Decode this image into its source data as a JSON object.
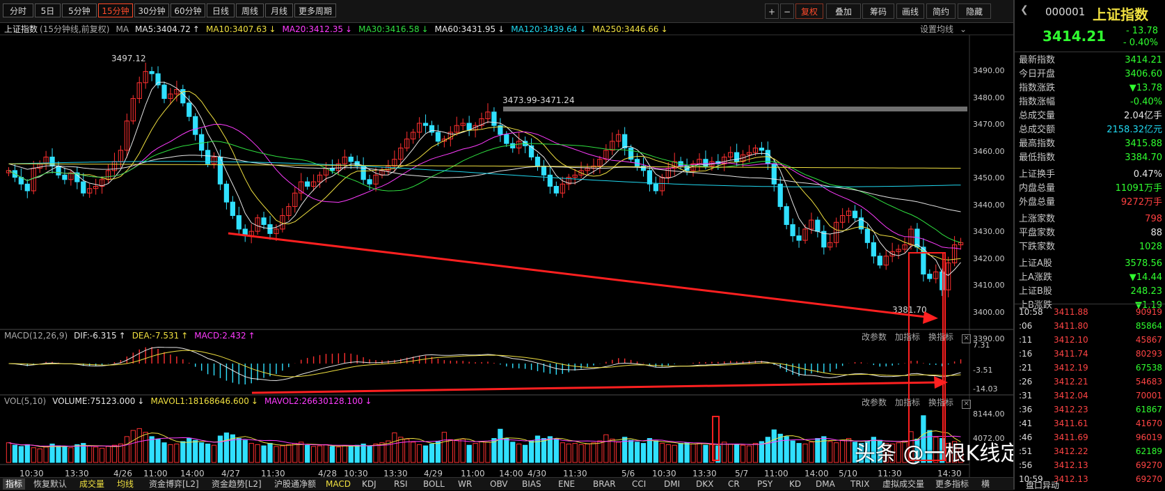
{
  "toolbar": {
    "periods": [
      "分时",
      "5日",
      "5分钟",
      "15分钟",
      "30分钟",
      "60分钟",
      "日线",
      "周线",
      "月线",
      "更多周期"
    ],
    "active_period": "15分钟",
    "right_buttons": [
      "复权",
      "叠加",
      "筹码",
      "画线",
      "简约",
      "隐藏"
    ],
    "plus": "+",
    "minus": "−"
  },
  "main": {
    "index_name": "上证指数",
    "subtitle": "(15分钟线,前复权)",
    "ma_tag": "MA",
    "ma": [
      {
        "label": "MA5:3404.72",
        "arrow": "↑",
        "color": "#e6e6e6"
      },
      {
        "label": "MA10:3407.63",
        "arrow": "↓",
        "color": "#f0e040"
      },
      {
        "label": "MA20:3412.35",
        "arrow": "↓",
        "color": "#ff3cff"
      },
      {
        "label": "MA30:3416.58",
        "arrow": "↓",
        "color": "#2fe040"
      },
      {
        "label": "MA60:3431.95",
        "arrow": "↓",
        "color": "#e6e6e6"
      },
      {
        "label": "MA120:3439.64",
        "arrow": "↓",
        "color": "#20d8f0"
      },
      {
        "label": "MA250:3446.66",
        "arrow": "↓",
        "color": "#f0e040"
      }
    ],
    "settings": "设置均线",
    "high_label": "3497.12",
    "range_label": "3473.99-3471.24",
    "low_label": "3381.70",
    "yticks": [
      "3490.00",
      "3480.00",
      "3470.00",
      "3460.00",
      "3450.00",
      "3440.00",
      "3430.00",
      "3420.00",
      "3410.00",
      "3400.00",
      "3390.00"
    ]
  },
  "macd": {
    "title": "MACD(12,26,9)",
    "dif": "DIF:-6.315",
    "dif_arrow": "↑",
    "dea": "DEA:-7.531",
    "dea_arrow": "↑",
    "macd": "MACD:2.432",
    "macd_arrow": "↑",
    "tools": [
      "改参数",
      "加指标",
      "换指标"
    ],
    "close": "×",
    "yticks": [
      "7.31",
      "-3.51",
      "-14.03"
    ]
  },
  "vol": {
    "title": "VOL(5,10)",
    "volume": "VOLUME:75123.000",
    "volume_arrow": "↓",
    "mavol1": "MAVOL1:18168646.600",
    "mavol1_arrow": "↓",
    "mavol2": "MAVOL2:26630128.100",
    "mavol2_arrow": "↓",
    "tools": [
      "改参数",
      "加指标",
      "换指标"
    ],
    "close": "×",
    "yticks": [
      "8144.00",
      "4072.00"
    ]
  },
  "xaxis": [
    "10:30",
    "13:30",
    "4/26",
    "11:00",
    "14:00",
    "4/27",
    "11:30",
    "4/28",
    "10:30",
    "13:30",
    "4/29",
    "11:00",
    "14:00",
    "4/30",
    "11:30",
    "5/6",
    "10:30",
    "13:30",
    "5/7",
    "11:00",
    "14:00",
    "5/10",
    "11:30",
    "14:30"
  ],
  "bottom_tabs": [
    "指标",
    "恢复默认",
    "成交量",
    "均线",
    "资金博弈[L2]",
    "资金趋势[L2]",
    "沪股通净额",
    "MACD",
    "KDJ",
    "RSI",
    "BOLL",
    "WR",
    "OBV",
    "BIAS",
    "ENE",
    "BRAR",
    "CCI",
    "DMI",
    "DKX",
    "CR",
    "PSY",
    "KD",
    "DMA",
    "TRIX",
    "虚拟成交量",
    "更多指标",
    "横"
  ],
  "watermark": "头条 @一根K线定乾坤",
  "quote": {
    "code": "000001",
    "name": "上证指数",
    "price": "3414.21",
    "change": "- 13.78",
    "pct": "- 0.40%",
    "stats": [
      {
        "k": "最新指数",
        "v": "3414.21",
        "c": "#30ff30"
      },
      {
        "k": "今日开盘",
        "v": "3406.60",
        "c": "#30ff30"
      },
      {
        "k": "指数涨跌",
        "v": "▼13.78",
        "c": "#30ff30"
      },
      {
        "k": "指数涨幅",
        "v": "-0.40%",
        "c": "#30ff30"
      },
      {
        "k": "总成交量",
        "v": "2.04亿手",
        "c": "#e6e6e6"
      },
      {
        "k": "总成交额",
        "v": "2158.32亿元",
        "c": "#20d8f0"
      },
      {
        "k": "最高指数",
        "v": "3415.88",
        "c": "#30ff30"
      },
      {
        "k": "最低指数",
        "v": "3384.70",
        "c": "#30ff30"
      },
      {
        "k": "上证换手",
        "v": "0.47%",
        "c": "#e6e6e6"
      },
      {
        "k": "内盘总量",
        "v": "11091万手",
        "c": "#30ff30"
      },
      {
        "k": "外盘总量",
        "v": "9272万手",
        "c": "#ff4040"
      },
      {
        "k": "上涨家数",
        "v": "798",
        "c": "#ff4040"
      },
      {
        "k": "平盘家数",
        "v": "88",
        "c": "#e6e6e6"
      },
      {
        "k": "下跌家数",
        "v": "1028",
        "c": "#30ff30"
      },
      {
        "k": "上证A股",
        "v": "3578.56",
        "c": "#30ff30"
      },
      {
        "k": "上A涨跌",
        "v": "▼14.44",
        "c": "#30ff30"
      },
      {
        "k": "上证B股",
        "v": "248.23",
        "c": "#30ff30"
      },
      {
        "k": "上B涨跌",
        "v": "▼1.19",
        "c": "#30ff30"
      }
    ],
    "ticks": [
      {
        "t": "10:58",
        "p": "3411.88",
        "v": "90919"
      },
      {
        "t": ":06",
        "p": "3411.80",
        "v": "85864"
      },
      {
        "t": ":11",
        "p": "3412.10",
        "v": "45867"
      },
      {
        "t": ":16",
        "p": "3411.74",
        "v": "80293"
      },
      {
        "t": ":21",
        "p": "3412.19",
        "v": "67538"
      },
      {
        "t": ":26",
        "p": "3412.21",
        "v": "54683"
      },
      {
        "t": ":31",
        "p": "3412.04",
        "v": "70001"
      },
      {
        "t": ":36",
        "p": "3412.23",
        "v": "61867"
      },
      {
        "t": ":41",
        "p": "3411.61",
        "v": "41670"
      },
      {
        "t": ":46",
        "p": "3411.69",
        "v": "96019"
      },
      {
        "t": ":51",
        "p": "3412.22",
        "v": "62189"
      },
      {
        "t": ":56",
        "p": "3412.13",
        "v": "69270"
      },
      {
        "t": "10:59",
        "p": "3412.13",
        "v": "69270"
      }
    ],
    "footer": "盘口异动"
  },
  "chart_data": {
    "type": "candlestick",
    "title": "上证指数 15分钟线",
    "closes": [
      3446,
      3443,
      3440,
      3437,
      3447,
      3449,
      3452,
      3448,
      3444,
      3442,
      3445,
      3441,
      3436,
      3438,
      3439,
      3442,
      3446,
      3450,
      3455,
      3468,
      3478,
      3485,
      3490,
      3489,
      3484,
      3478,
      3480,
      3482,
      3476,
      3470,
      3462,
      3455,
      3449,
      3452,
      3440,
      3432,
      3426,
      3420,
      3417,
      3419,
      3425,
      3422,
      3418,
      3420,
      3426,
      3430,
      3436,
      3441,
      3439,
      3441,
      3444,
      3447,
      3446,
      3449,
      3452,
      3450,
      3448,
      3442,
      3440,
      3444,
      3446,
      3448,
      3451,
      3456,
      3460,
      3463,
      3467,
      3466,
      3463,
      3459,
      3460,
      3463,
      3466,
      3467,
      3464,
      3466,
      3469,
      3472,
      3466,
      3462,
      3458,
      3456,
      3459,
      3457,
      3452,
      3448,
      3444,
      3439,
      3436,
      3440,
      3443,
      3444,
      3446,
      3447,
      3448,
      3451,
      3455,
      3459,
      3462,
      3456,
      3451,
      3448,
      3446,
      3440,
      3437,
      3443,
      3447,
      3450,
      3448,
      3446,
      3449,
      3451,
      3448,
      3450,
      3449,
      3452,
      3454,
      3450,
      3453,
      3454,
      3456,
      3455,
      3449,
      3440,
      3430,
      3422,
      3417,
      3415,
      3420,
      3424,
      3419,
      3412,
      3414,
      3423,
      3426,
      3428,
      3425,
      3420,
      3414,
      3408,
      3404,
      3408,
      3410,
      3411,
      3413,
      3420,
      3412,
      3400,
      3398,
      3401,
      3393,
      3405,
      3413,
      3414
    ],
    "volumes": [
      3200,
      2800,
      2600,
      2900,
      2400,
      2200,
      2500,
      3000,
      2700,
      2600,
      2400,
      2900,
      3100,
      2700,
      2500,
      2300,
      2600,
      2800,
      3000,
      4200,
      5200,
      5500,
      4900,
      4200,
      3800,
      3200,
      2900,
      3000,
      3400,
      3900,
      3600,
      3200,
      3000,
      2800,
      4300,
      4800,
      4500,
      3900,
      3600,
      3100,
      2900,
      2700,
      3100,
      2600,
      2700,
      2900,
      3100,
      3300,
      2800,
      2600,
      2700,
      2900,
      2600,
      2500,
      2700,
      2600,
      2800,
      3000,
      2600,
      3000,
      3200,
      3500,
      4800,
      4100,
      3800,
      3300,
      2900,
      2700,
      3000,
      3400,
      4900,
      3700,
      3600,
      3800,
      2800,
      3100,
      3400,
      3300,
      3900,
      5400,
      3900,
      3300,
      3000,
      2800,
      3500,
      4300,
      3900,
      4200,
      3800,
      3200,
      3000,
      3100,
      2900,
      3000,
      3200,
      3500,
      4500,
      3800,
      3300,
      4100,
      3600,
      3300,
      3100,
      3900,
      3500,
      3100,
      2900,
      2800,
      3100,
      3200,
      3000,
      3100,
      2800,
      2900,
      2700,
      3300,
      3000,
      2900,
      2800,
      2700,
      3100,
      3400,
      4100,
      5300,
      4600,
      4200,
      3500,
      3100,
      3000,
      3300,
      3900,
      4200,
      3400,
      3200,
      3600,
      3900,
      3300,
      3100,
      3500,
      4100,
      3600,
      3100,
      3000,
      3200,
      3500,
      5000,
      3800,
      7600,
      5200,
      4100,
      3900,
      3100,
      3400,
      2200
    ],
    "ylim": [
      3381.7,
      3497.12
    ]
  }
}
